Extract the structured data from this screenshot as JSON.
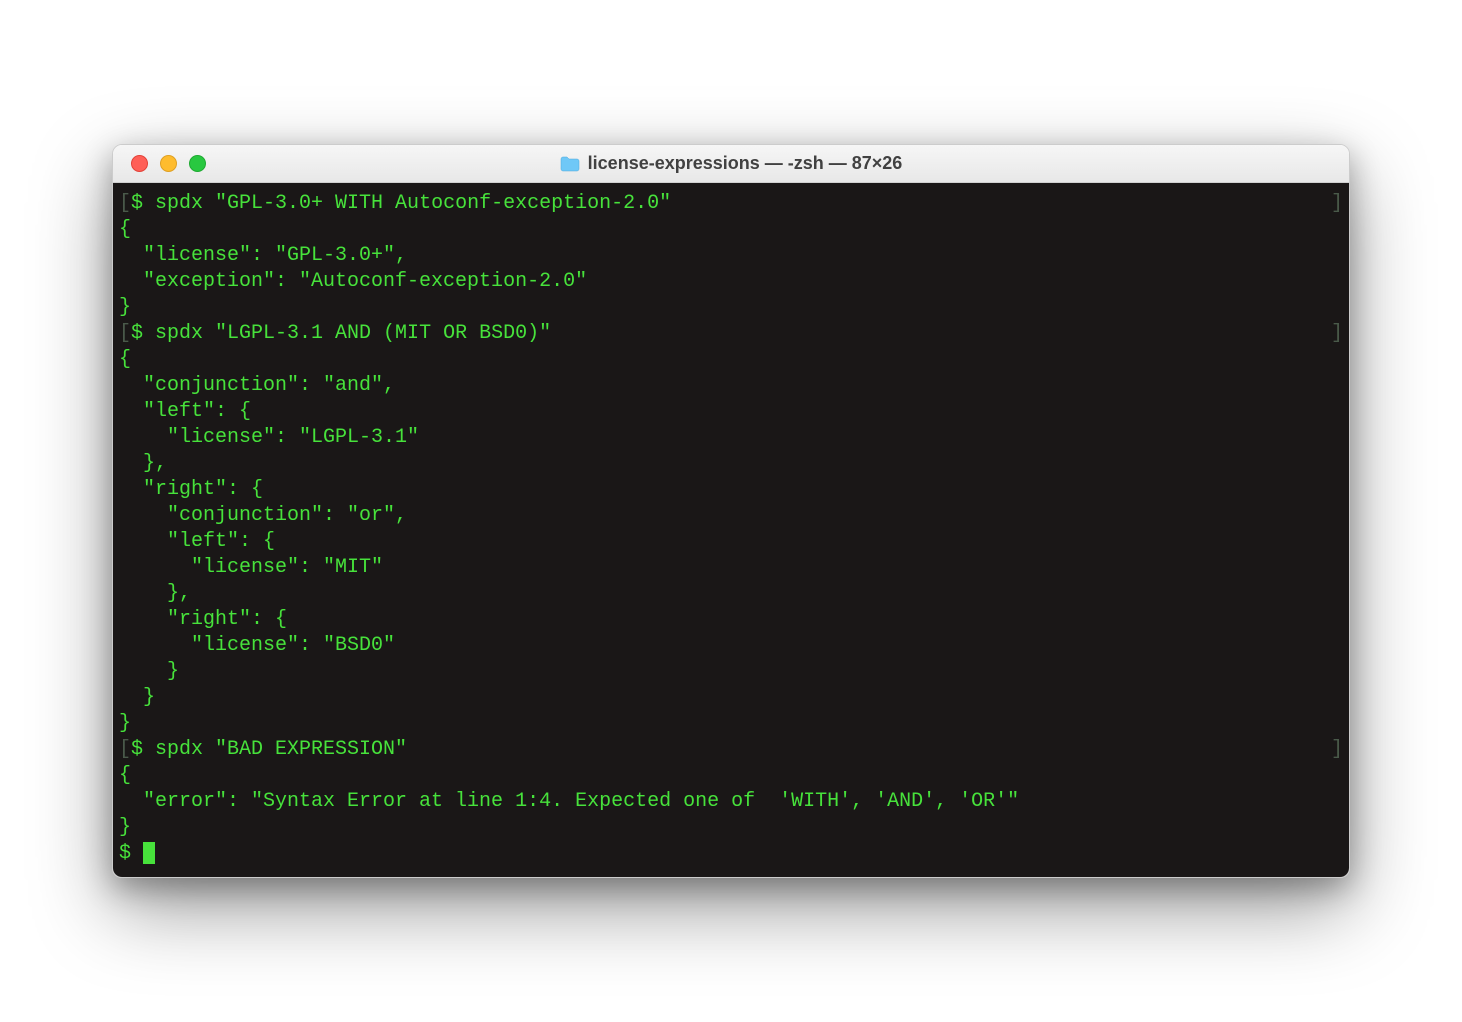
{
  "window": {
    "title": "license-expressions — -zsh — 87×26"
  },
  "terminal": {
    "lines": [
      {
        "type": "prompt",
        "text": "$ spdx \"GPL-3.0+ WITH Autoconf-exception-2.0\""
      },
      {
        "type": "out",
        "text": "{"
      },
      {
        "type": "out",
        "text": "  \"license\": \"GPL-3.0+\","
      },
      {
        "type": "out",
        "text": "  \"exception\": \"Autoconf-exception-2.0\""
      },
      {
        "type": "out",
        "text": "}"
      },
      {
        "type": "prompt",
        "text": "$ spdx \"LGPL-3.1 AND (MIT OR BSD0)\""
      },
      {
        "type": "out",
        "text": "{"
      },
      {
        "type": "out",
        "text": "  \"conjunction\": \"and\","
      },
      {
        "type": "out",
        "text": "  \"left\": {"
      },
      {
        "type": "out",
        "text": "    \"license\": \"LGPL-3.1\""
      },
      {
        "type": "out",
        "text": "  },"
      },
      {
        "type": "out",
        "text": "  \"right\": {"
      },
      {
        "type": "out",
        "text": "    \"conjunction\": \"or\","
      },
      {
        "type": "out",
        "text": "    \"left\": {"
      },
      {
        "type": "out",
        "text": "      \"license\": \"MIT\""
      },
      {
        "type": "out",
        "text": "    },"
      },
      {
        "type": "out",
        "text": "    \"right\": {"
      },
      {
        "type": "out",
        "text": "      \"license\": \"BSD0\""
      },
      {
        "type": "out",
        "text": "    }"
      },
      {
        "type": "out",
        "text": "  }"
      },
      {
        "type": "out",
        "text": "}"
      },
      {
        "type": "prompt",
        "text": "$ spdx \"BAD EXPRESSION\""
      },
      {
        "type": "out",
        "text": "{"
      },
      {
        "type": "out",
        "text": "  \"error\": \"Syntax Error at line 1:4. Expected one of  'WITH', 'AND', 'OR'\""
      },
      {
        "type": "out",
        "text": "}"
      },
      {
        "type": "cursor",
        "text": "$ "
      }
    ]
  }
}
